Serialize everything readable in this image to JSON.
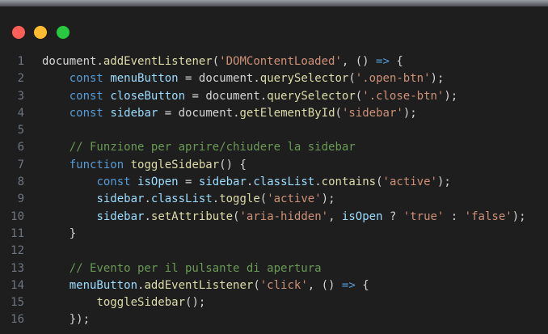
{
  "colors": {
    "background": "#1e1e1e",
    "dot_red": "#ff5f57",
    "dot_yellow": "#febc2e",
    "dot_green": "#28c840"
  },
  "window_controls": [
    {
      "name": "close",
      "color": "#ff5f57"
    },
    {
      "name": "minimize",
      "color": "#febc2e"
    },
    {
      "name": "maximize",
      "color": "#28c840"
    }
  ],
  "code": {
    "language": "javascript",
    "lines": [
      {
        "number": "1",
        "tokens": [
          {
            "t": "document",
            "c": "plain"
          },
          {
            "t": ".",
            "c": "plain"
          },
          {
            "t": "addEventListener",
            "c": "fn"
          },
          {
            "t": "(",
            "c": "plain"
          },
          {
            "t": "'DOMContentLoaded'",
            "c": "string"
          },
          {
            "t": ", () ",
            "c": "plain"
          },
          {
            "t": "=>",
            "c": "keyword"
          },
          {
            "t": " {",
            "c": "plain"
          }
        ]
      },
      {
        "number": "2",
        "tokens": [
          {
            "t": "    ",
            "c": "plain"
          },
          {
            "t": "const",
            "c": "keyword"
          },
          {
            "t": " ",
            "c": "plain"
          },
          {
            "t": "menuButton",
            "c": "var"
          },
          {
            "t": " = ",
            "c": "plain"
          },
          {
            "t": "document",
            "c": "plain"
          },
          {
            "t": ".",
            "c": "plain"
          },
          {
            "t": "querySelector",
            "c": "fn"
          },
          {
            "t": "(",
            "c": "plain"
          },
          {
            "t": "'.open-btn'",
            "c": "string"
          },
          {
            "t": ");",
            "c": "plain"
          }
        ]
      },
      {
        "number": "3",
        "tokens": [
          {
            "t": "    ",
            "c": "plain"
          },
          {
            "t": "const",
            "c": "keyword"
          },
          {
            "t": " ",
            "c": "plain"
          },
          {
            "t": "closeButton",
            "c": "var"
          },
          {
            "t": " = ",
            "c": "plain"
          },
          {
            "t": "document",
            "c": "plain"
          },
          {
            "t": ".",
            "c": "plain"
          },
          {
            "t": "querySelector",
            "c": "fn"
          },
          {
            "t": "(",
            "c": "plain"
          },
          {
            "t": "'.close-btn'",
            "c": "string"
          },
          {
            "t": ");",
            "c": "plain"
          }
        ]
      },
      {
        "number": "4",
        "tokens": [
          {
            "t": "    ",
            "c": "plain"
          },
          {
            "t": "const",
            "c": "keyword"
          },
          {
            "t": " ",
            "c": "plain"
          },
          {
            "t": "sidebar",
            "c": "var"
          },
          {
            "t": " = ",
            "c": "plain"
          },
          {
            "t": "document",
            "c": "plain"
          },
          {
            "t": ".",
            "c": "plain"
          },
          {
            "t": "getElementById",
            "c": "fn"
          },
          {
            "t": "(",
            "c": "plain"
          },
          {
            "t": "'sidebar'",
            "c": "string"
          },
          {
            "t": ");",
            "c": "plain"
          }
        ]
      },
      {
        "number": "5",
        "tokens": []
      },
      {
        "number": "6",
        "tokens": [
          {
            "t": "    ",
            "c": "plain"
          },
          {
            "t": "// Funzione per aprire/chiudere la sidebar",
            "c": "comment"
          }
        ]
      },
      {
        "number": "7",
        "tokens": [
          {
            "t": "    ",
            "c": "plain"
          },
          {
            "t": "function",
            "c": "keyword"
          },
          {
            "t": " ",
            "c": "plain"
          },
          {
            "t": "toggleSidebar",
            "c": "fn"
          },
          {
            "t": "() {",
            "c": "plain"
          }
        ]
      },
      {
        "number": "8",
        "tokens": [
          {
            "t": "        ",
            "c": "plain"
          },
          {
            "t": "const",
            "c": "keyword"
          },
          {
            "t": " ",
            "c": "plain"
          },
          {
            "t": "isOpen",
            "c": "var"
          },
          {
            "t": " = ",
            "c": "plain"
          },
          {
            "t": "sidebar",
            "c": "var"
          },
          {
            "t": ".",
            "c": "plain"
          },
          {
            "t": "classList",
            "c": "var"
          },
          {
            "t": ".",
            "c": "plain"
          },
          {
            "t": "contains",
            "c": "fn"
          },
          {
            "t": "(",
            "c": "plain"
          },
          {
            "t": "'active'",
            "c": "string"
          },
          {
            "t": ");",
            "c": "plain"
          }
        ]
      },
      {
        "number": "9",
        "tokens": [
          {
            "t": "        ",
            "c": "plain"
          },
          {
            "t": "sidebar",
            "c": "var"
          },
          {
            "t": ".",
            "c": "plain"
          },
          {
            "t": "classList",
            "c": "var"
          },
          {
            "t": ".",
            "c": "plain"
          },
          {
            "t": "toggle",
            "c": "fn"
          },
          {
            "t": "(",
            "c": "plain"
          },
          {
            "t": "'active'",
            "c": "string"
          },
          {
            "t": ");",
            "c": "plain"
          }
        ]
      },
      {
        "number": "10",
        "tokens": [
          {
            "t": "        ",
            "c": "plain"
          },
          {
            "t": "sidebar",
            "c": "var"
          },
          {
            "t": ".",
            "c": "plain"
          },
          {
            "t": "setAttribute",
            "c": "fn"
          },
          {
            "t": "(",
            "c": "plain"
          },
          {
            "t": "'aria-hidden'",
            "c": "string"
          },
          {
            "t": ", ",
            "c": "plain"
          },
          {
            "t": "isOpen",
            "c": "var"
          },
          {
            "t": " ? ",
            "c": "plain"
          },
          {
            "t": "'true'",
            "c": "string"
          },
          {
            "t": " : ",
            "c": "plain"
          },
          {
            "t": "'false'",
            "c": "string"
          },
          {
            "t": ");",
            "c": "plain"
          }
        ]
      },
      {
        "number": "11",
        "tokens": [
          {
            "t": "    }",
            "c": "plain"
          }
        ]
      },
      {
        "number": "12",
        "tokens": []
      },
      {
        "number": "13",
        "tokens": [
          {
            "t": "    ",
            "c": "plain"
          },
          {
            "t": "// Evento per il pulsante di apertura",
            "c": "comment"
          }
        ]
      },
      {
        "number": "14",
        "tokens": [
          {
            "t": "    ",
            "c": "plain"
          },
          {
            "t": "menuButton",
            "c": "var"
          },
          {
            "t": ".",
            "c": "plain"
          },
          {
            "t": "addEventListener",
            "c": "fn"
          },
          {
            "t": "(",
            "c": "plain"
          },
          {
            "t": "'click'",
            "c": "string"
          },
          {
            "t": ", () ",
            "c": "plain"
          },
          {
            "t": "=>",
            "c": "keyword"
          },
          {
            "t": " {",
            "c": "plain"
          }
        ]
      },
      {
        "number": "15",
        "tokens": [
          {
            "t": "        ",
            "c": "plain"
          },
          {
            "t": "toggleSidebar",
            "c": "fn"
          },
          {
            "t": "();",
            "c": "plain"
          }
        ]
      },
      {
        "number": "16",
        "tokens": [
          {
            "t": "    });",
            "c": "plain"
          }
        ]
      }
    ]
  }
}
